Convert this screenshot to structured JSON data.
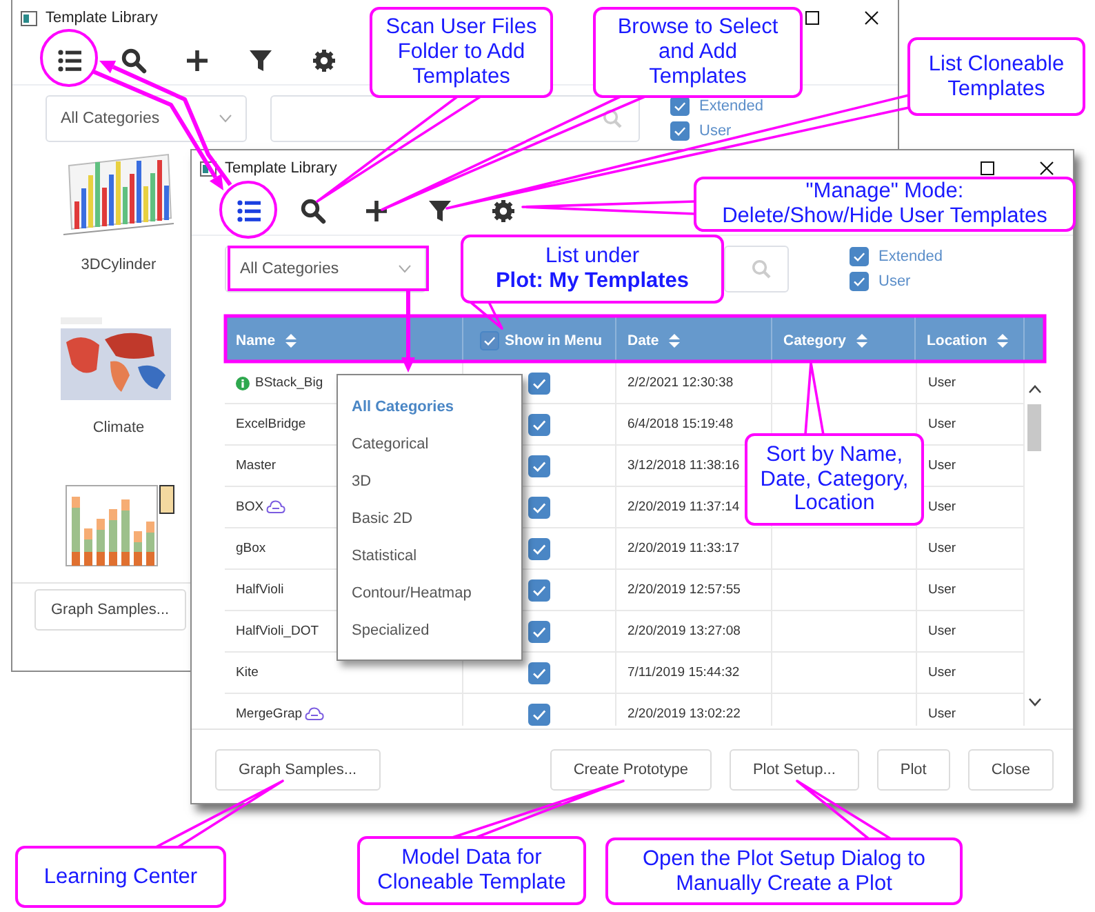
{
  "back_window": {
    "title": "Template Library",
    "toolbar": [
      {
        "kind": "list",
        "selected": false
      },
      {
        "kind": "search",
        "selected": false
      },
      {
        "kind": "add",
        "selected": false
      },
      {
        "kind": "filter",
        "selected": false
      },
      {
        "kind": "settings",
        "selected": false
      }
    ],
    "category_select": "All Categories",
    "checkboxes": [
      {
        "label": "Extended",
        "checked": true
      },
      {
        "label": "User",
        "checked": true
      }
    ],
    "templates": [
      {
        "name": "3DCylinder",
        "kind": "bars-3d"
      },
      {
        "name": "Climate",
        "kind": "map"
      },
      {
        "kind": "stacked-bars"
      }
    ],
    "footer": {
      "left_buttons": [
        "Graph Samples..."
      ]
    }
  },
  "front_window": {
    "title": "Template Library",
    "toolbar": [
      {
        "kind": "list",
        "selected": true
      },
      {
        "kind": "search",
        "selected": false
      },
      {
        "kind": "add",
        "selected": false
      },
      {
        "kind": "filter",
        "selected": false
      },
      {
        "kind": "settings",
        "selected": false
      }
    ],
    "category_select": "All Categories",
    "checkboxes": [
      {
        "label": "Extended",
        "checked": true
      },
      {
        "label": "User",
        "checked": true
      }
    ],
    "table": {
      "columns": [
        {
          "label": "Name",
          "kind": "sort"
        },
        {
          "label": "Show in Menu",
          "kind": "checkbox",
          "checked": true
        },
        {
          "label": "Date",
          "kind": "sort"
        },
        {
          "label": "Category",
          "kind": "sort"
        },
        {
          "label": "Location",
          "kind": "sort"
        }
      ],
      "rows": [
        {
          "name": "BStack_Big",
          "kind": "info",
          "show_in_menu": true,
          "date": "2/2/2021 12:30:38",
          "location": "User"
        },
        {
          "name": "ExcelBridge",
          "kind": "plain",
          "show_in_menu": true,
          "date": "6/4/2018 15:19:48",
          "location": "User"
        },
        {
          "name": "Master",
          "kind": "plain",
          "show_in_menu": true,
          "date": "3/12/2018 11:38:16",
          "location": "User"
        },
        {
          "name": "BOX",
          "kind": "cloneable",
          "show_in_menu": true,
          "date": "2/20/2019 11:37:14",
          "location": "User"
        },
        {
          "name": "gBox",
          "kind": "plain",
          "show_in_menu": true,
          "date": "2/20/2019 11:33:17",
          "location": "User"
        },
        {
          "name": "HalfVioli",
          "kind": "plain",
          "show_in_menu": true,
          "date": "2/20/2019 12:57:55",
          "location": "User"
        },
        {
          "name": "HalfVioli_DOT",
          "kind": "plain",
          "show_in_menu": true,
          "date": "2/20/2019 13:27:08",
          "location": "User"
        },
        {
          "name": "Kite",
          "kind": "plain",
          "show_in_menu": true,
          "date": "7/11/2019 15:44:32",
          "location": "User"
        },
        {
          "name": "MergeGrap",
          "kind": "cloneable",
          "show_in_menu": true,
          "date": "2/20/2019 13:02:22",
          "location": "User"
        }
      ]
    },
    "category_menu": {
      "items": [
        {
          "label": "All Categories",
          "selected": true
        },
        {
          "label": "Categorical",
          "selected": false
        },
        {
          "label": "3D",
          "selected": false
        },
        {
          "label": "Basic 2D",
          "selected": false
        },
        {
          "label": "Statistical",
          "selected": false
        },
        {
          "label": "Contour/Heatmap",
          "selected": false
        },
        {
          "label": "Specialized",
          "selected": false
        }
      ]
    },
    "footer": {
      "left_buttons": [
        "Graph Samples..."
      ],
      "right_buttons": [
        "Create Prototype",
        "Plot Setup...",
        "Plot",
        "Close"
      ]
    }
  },
  "callouts": [
    {
      "text": "Scan User Files\nFolder to Add\nTemplates"
    },
    {
      "text": "Browse to Select\nand Add\nTemplates"
    },
    {
      "text": "List Cloneable\nTemplates"
    },
    {
      "text": "\"Manage\" Mode:\nDelete/Show/Hide User Templates"
    },
    {
      "text": "List under\n**Plot: My Templates**"
    },
    {
      "text": "Sort by Name,\nDate, Category,\nLocation"
    },
    {
      "text": "Learning Center"
    },
    {
      "text": "Model Data for\nCloneable Template"
    },
    {
      "text": "Open the Plot Setup Dialog to\nManually Create a Plot"
    }
  ]
}
